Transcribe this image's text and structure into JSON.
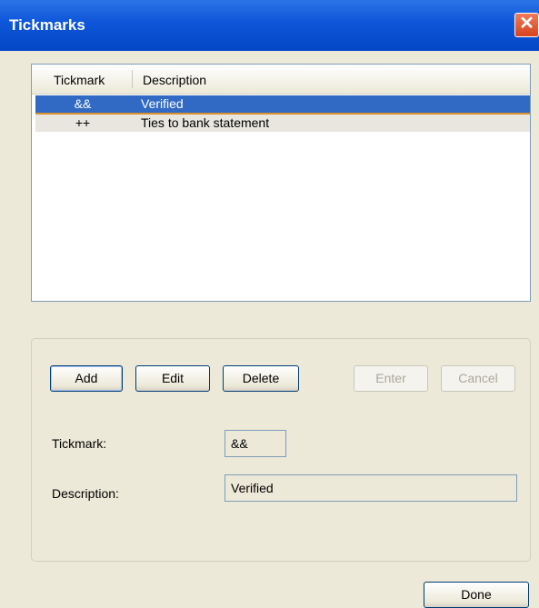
{
  "window": {
    "title": "Tickmarks",
    "close_glyph": "✕"
  },
  "list": {
    "columns": [
      "Tickmark",
      "Description"
    ],
    "rows": [
      {
        "tickmark": "&&",
        "description": "Verified"
      },
      {
        "tickmark": "++",
        "description": "Ties to bank statement"
      }
    ]
  },
  "buttons": {
    "add": "Add",
    "edit": "Edit",
    "delete": "Delete",
    "enter": "Enter",
    "cancel": "Cancel",
    "done": "Done"
  },
  "form": {
    "tickmark_label": "Tickmark:",
    "tickmark_value": "&&",
    "description_label": "Description:",
    "description_value": "Verified"
  },
  "colors": {
    "titlebar": "#0d55d8",
    "selection": "#316ac5",
    "background": "#ece9d8"
  }
}
